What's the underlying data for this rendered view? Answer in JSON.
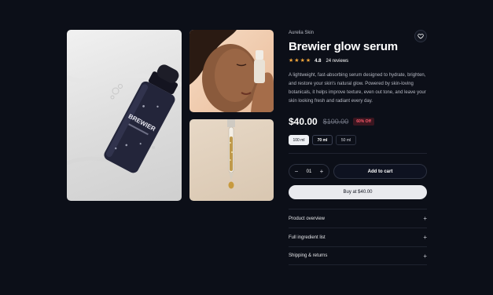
{
  "product": {
    "brand": "Aurelia Skin",
    "title": "Brewier glow serum",
    "bottle_label": "BREWIER",
    "rating": "4.8",
    "reviews": "24 reviews",
    "stars": 4,
    "description": "A lightweight, fast-absorbing serum designed to hydrate, brighten, and restore your skin's natural glow. Powered by skin-loving botanicals, it helps improve texture, even out tone, and leave your skin looking fresh and radiant every day.",
    "price": "$40.00",
    "old_price": "$100.00",
    "discount": "60% Off"
  },
  "sizes": [
    {
      "label": "100 ml",
      "state": "selected"
    },
    {
      "label": "70 ml",
      "state": "hover"
    },
    {
      "label": "50 ml",
      "state": "default"
    }
  ],
  "cart": {
    "minus": "−",
    "quantity": "01",
    "plus": "+",
    "add_to_cart": "Add to cart",
    "buy_now": "Buy at $40.00"
  },
  "accordion": [
    {
      "label": "Product overview",
      "icon": "+"
    },
    {
      "label": "Full ingredient list",
      "icon": "+"
    },
    {
      "label": "Shipping & returns",
      "icon": "+"
    }
  ],
  "icons": {
    "wishlist": "heart-icon",
    "star": "star-icon",
    "accordion_toggle": "plus-icon"
  },
  "colors": {
    "background": "#0c0f18",
    "star": "#f0a53b",
    "discount": "#ff5a6a",
    "buy_button": "#e9eaee"
  }
}
